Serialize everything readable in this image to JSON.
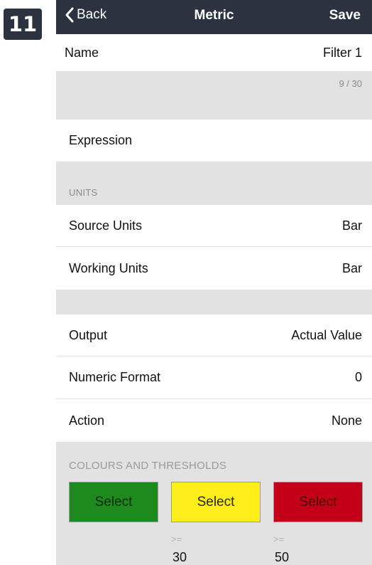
{
  "step_badge": "11",
  "navbar": {
    "back_label": "Back",
    "title": "Metric",
    "save_label": "Save"
  },
  "name_row": {
    "label": "Name",
    "value": "Filter 1"
  },
  "name_counter": "9 / 30",
  "expression_row": {
    "label": "Expression"
  },
  "units_section": {
    "header": "UNITS",
    "source_units": {
      "label": "Source Units",
      "value": "Bar"
    },
    "working_units": {
      "label": "Working Units",
      "value": "Bar"
    }
  },
  "output_section": {
    "output": {
      "label": "Output",
      "value": "Actual Value"
    },
    "numeric_format": {
      "label": "Numeric Format",
      "value": "0"
    },
    "action": {
      "label": "Action",
      "value": "None"
    }
  },
  "colours_section": {
    "header": "COLOURS AND THRESHOLDS",
    "buttons": [
      {
        "label": "Select",
        "color": "#1e8a1e",
        "text_color": "#0b2a0b"
      },
      {
        "label": "Select",
        "color": "#ffee1a",
        "text_color": "#2a2600"
      },
      {
        "label": "Select",
        "color": "#c40018",
        "text_color": "#4a0008"
      }
    ],
    "thresholds": [
      {
        "operator": ">=",
        "value": "30"
      },
      {
        "operator": ">=",
        "value": "50"
      }
    ]
  },
  "colors": {
    "navbar_bg": "#2b3240",
    "section_gray": "#e2e2e2"
  }
}
